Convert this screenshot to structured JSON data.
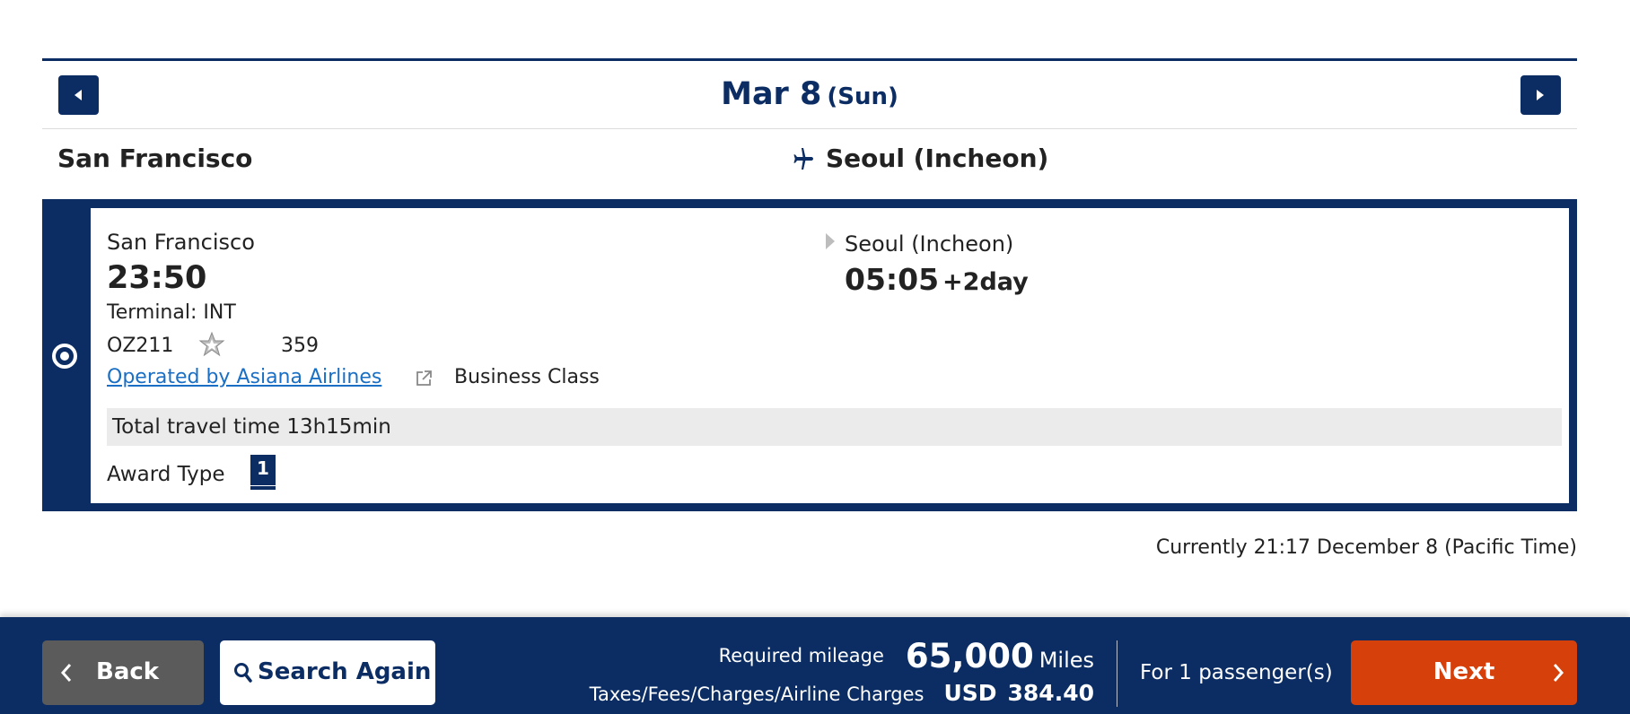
{
  "date_header": {
    "date": "Mar 8",
    "day_of_week": "(Sun)"
  },
  "route": {
    "origin": "San Francisco",
    "destination": "Seoul (Incheon)"
  },
  "flight": {
    "departure_city": "San Francisco",
    "departure_time": "23:50",
    "terminal": "Terminal: INT",
    "flight_number": "OZ211",
    "aircraft": "359",
    "operated_by": "Operated by Asiana Airlines",
    "cabin_class": "Business Class",
    "arrival_city": "Seoul (Incheon)",
    "arrival_time": "05:05",
    "arrival_day_offset": "+2day",
    "total_travel_time": "Total travel time 13h15min",
    "award_type_label": "Award Type",
    "award_type_value": "1",
    "selected": false
  },
  "current_time": "Currently 21:17 December 8 (Pacific Time)",
  "footer": {
    "back_label": "Back",
    "search_again_label": "Search Again",
    "required_mileage_label": "Required mileage",
    "required_mileage_value": "65,000",
    "mileage_unit": "Miles",
    "taxes_label": "Taxes/Fees/Charges/Airline Charges",
    "taxes_currency": "USD",
    "taxes_value": "384.40",
    "passengers": "For 1 passenger(s)",
    "next_label": "Next"
  },
  "colors": {
    "brand_navy": "#0b2d63",
    "next_orange": "#d6400a",
    "link_blue": "#1a6fc4",
    "back_gray": "#5b5b5b"
  },
  "icons": [
    "caret-left-icon",
    "caret-right-icon",
    "airplane-icon",
    "star-alliance-icon",
    "external-link-icon",
    "arrow-right-icon",
    "chevron-left-icon",
    "search-icon",
    "chevron-right-icon"
  ]
}
